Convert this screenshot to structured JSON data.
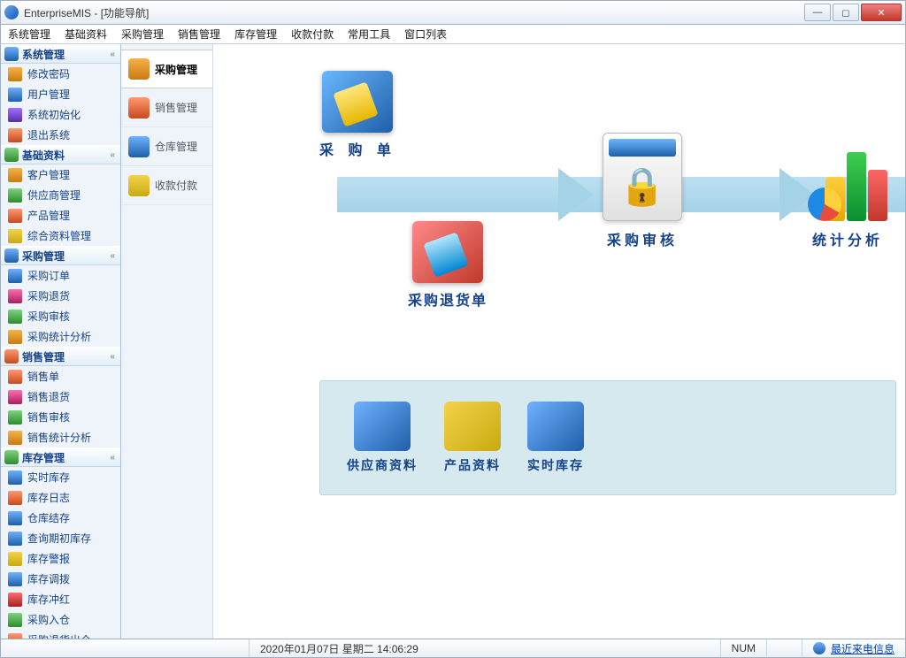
{
  "window": {
    "title": "EnterpriseMIS - [功能导航]"
  },
  "menus": [
    "系统管理",
    "基础资料",
    "采购管理",
    "销售管理",
    "库存管理",
    "收款付款",
    "常用工具",
    "窗口列表"
  ],
  "sidebar": {
    "groups": [
      {
        "title": "系统管理",
        "items": [
          "修改密码",
          "用户管理",
          "系统初始化",
          "退出系统"
        ]
      },
      {
        "title": "基础资料",
        "items": [
          "客户管理",
          "供应商管理",
          "产品管理",
          "综合资料管理"
        ]
      },
      {
        "title": "采购管理",
        "items": [
          "采购订单",
          "采购退货",
          "采购审核",
          "采购统计分析"
        ]
      },
      {
        "title": "销售管理",
        "items": [
          "销售单",
          "销售退货",
          "销售审核",
          "销售统计分析"
        ]
      },
      {
        "title": "库存管理",
        "items": [
          "实时库存",
          "库存日志",
          "仓库结存",
          "查询期初库存",
          "库存警报",
          "库存调拨",
          "库存冲红",
          "采购入仓",
          "采购退货出仓"
        ]
      }
    ]
  },
  "vtabs": [
    {
      "label": "采购管理",
      "active": true
    },
    {
      "label": "销售管理",
      "active": false
    },
    {
      "label": "仓库管理",
      "active": false
    },
    {
      "label": "收款付款",
      "active": false
    }
  ],
  "nodes": {
    "order": "采 购 单",
    "return": "采购退货单",
    "audit": "采购审核",
    "stats": "统计分析"
  },
  "bottom": {
    "supplier": "供应商资料",
    "product": "产品资料",
    "stock": "实时库存"
  },
  "status": {
    "datetime": "2020年01月07日 星期二 14:06:29",
    "num": "NUM",
    "recent": "最近来电信息"
  }
}
